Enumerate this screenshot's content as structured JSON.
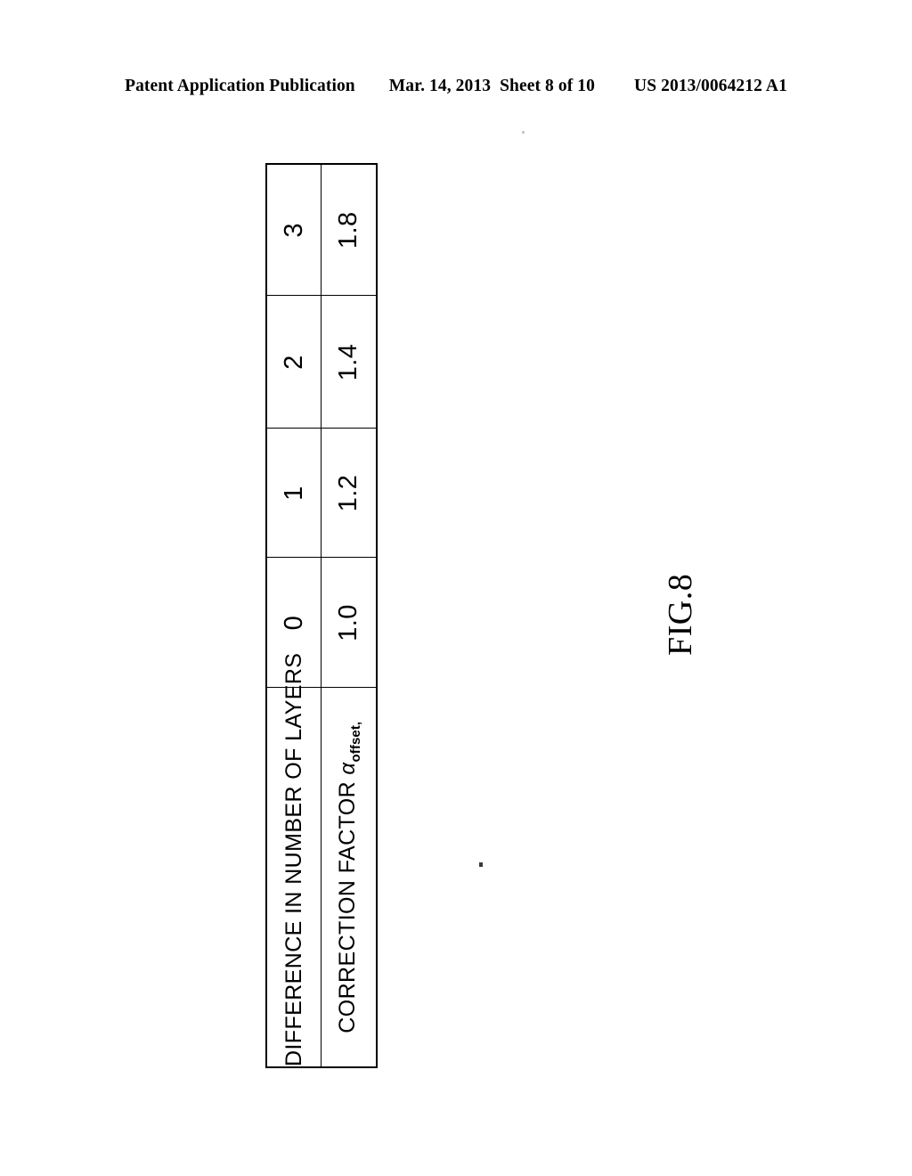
{
  "header": {
    "publication": "Patent Application Publication",
    "date": "Mar. 14, 2013",
    "sheet": "Sheet 8 of 10",
    "document_number": "US 2013/0064212 A1"
  },
  "figure": {
    "caption": "FIG.8",
    "rotation_degrees": -90
  },
  "chart_data": {
    "type": "table",
    "title": "FIG.8",
    "orientation": "rotated-90-ccw",
    "row_headers": [
      "DIFFERENCE IN NUMBER OF LAYERS",
      "CORRECTION FACTOR"
    ],
    "row_header_symbols": [
      "",
      "αoffset,"
    ],
    "rows": [
      {
        "label": "DIFFERENCE IN NUMBER OF LAYERS",
        "symbol_base": "",
        "symbol_sub": "",
        "values": [
          "0",
          "1",
          "2",
          "3"
        ]
      },
      {
        "label": "CORRECTION FACTOR",
        "symbol_base": "α",
        "symbol_sub": "offset,",
        "values": [
          "1.0",
          "1.2",
          "1.4",
          "1.8"
        ]
      }
    ],
    "categories": [
      "0",
      "1",
      "2",
      "3"
    ],
    "series": [
      {
        "name": "CORRECTION FACTOR αoffset,",
        "values": [
          1.0,
          1.2,
          1.4,
          1.8
        ]
      }
    ],
    "xlabel": "DIFFERENCE IN NUMBER OF LAYERS",
    "ylabel": "CORRECTION FACTOR αoffset,"
  },
  "colors": {
    "ink": "#000000",
    "page": "#ffffff"
  }
}
